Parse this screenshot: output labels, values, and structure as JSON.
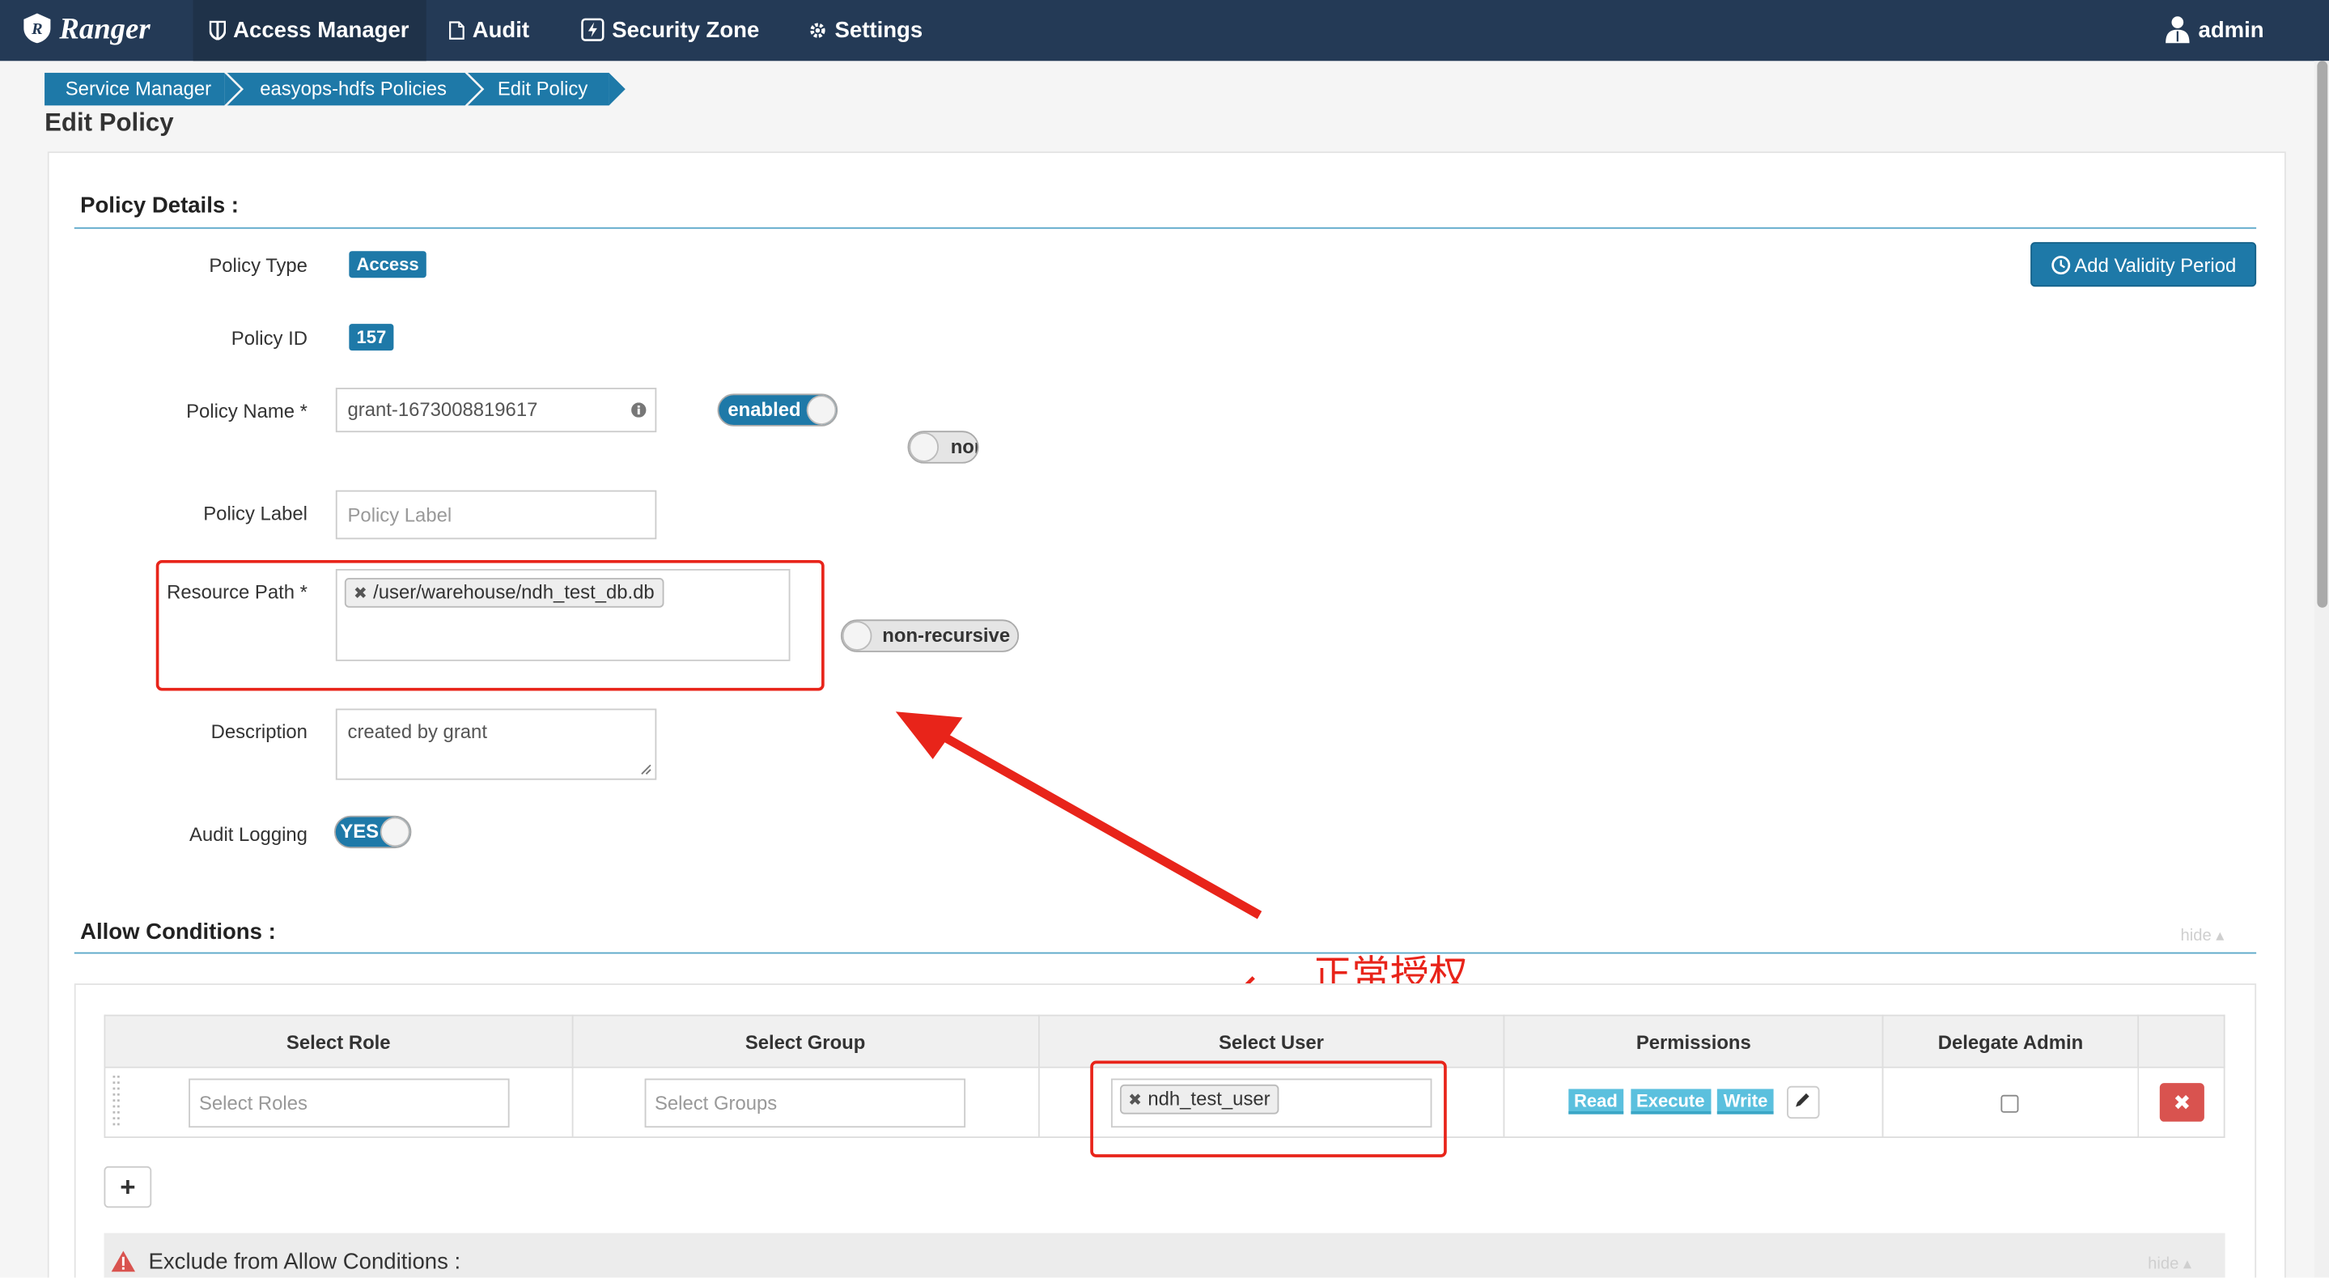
{
  "navbar": {
    "brand": "Ranger",
    "items": [
      {
        "label": "Access Manager"
      },
      {
        "label": "Audit"
      },
      {
        "label": "Security Zone"
      },
      {
        "label": "Settings"
      }
    ],
    "user": "admin"
  },
  "breadcrumb": [
    "Service Manager",
    "easyops-hdfs Policies",
    "Edit Policy"
  ],
  "page_title": "Edit Policy",
  "policy_details": {
    "section_title": "Policy Details :",
    "add_validity_period": "Add Validity Period",
    "policy_type_label": "Policy Type",
    "policy_type_value": "Access",
    "policy_id_label": "Policy ID",
    "policy_id_value": "157",
    "policy_name_label": "Policy Name *",
    "policy_name_value": "grant-1673008819617",
    "enabled_toggle": "enabled",
    "override_toggle": "nor",
    "policy_label_label": "Policy Label",
    "policy_label_placeholder": "Policy Label",
    "resource_path_label": "Resource Path *",
    "resource_path_tag": "/user/warehouse/ndh_test_db.db",
    "recursive_toggle": "non-recursive",
    "description_label": "Description",
    "description_value": "created by grant",
    "audit_logging_label": "Audit Logging",
    "audit_logging_toggle": "YES"
  },
  "annotation": {
    "text": "正常授权",
    "color": "#e8241a"
  },
  "allow_conditions": {
    "section_title": "Allow Conditions :",
    "hide": "hide",
    "columns": [
      "Select Role",
      "Select Group",
      "Select User",
      "Permissions",
      "Delegate Admin"
    ],
    "row": {
      "role_placeholder": "Select Roles",
      "group_placeholder": "Select Groups",
      "user_tag": "ndh_test_user",
      "permissions": [
        "Read",
        "Execute",
        "Write"
      ]
    },
    "add_button": "+"
  },
  "exclude": {
    "title": "Exclude from Allow Conditions :",
    "hide": "hide"
  },
  "colors": {
    "navbar": "#243a56",
    "accent": "#1e79a8",
    "permission": "#5bc0de",
    "delete": "#d9534f"
  }
}
